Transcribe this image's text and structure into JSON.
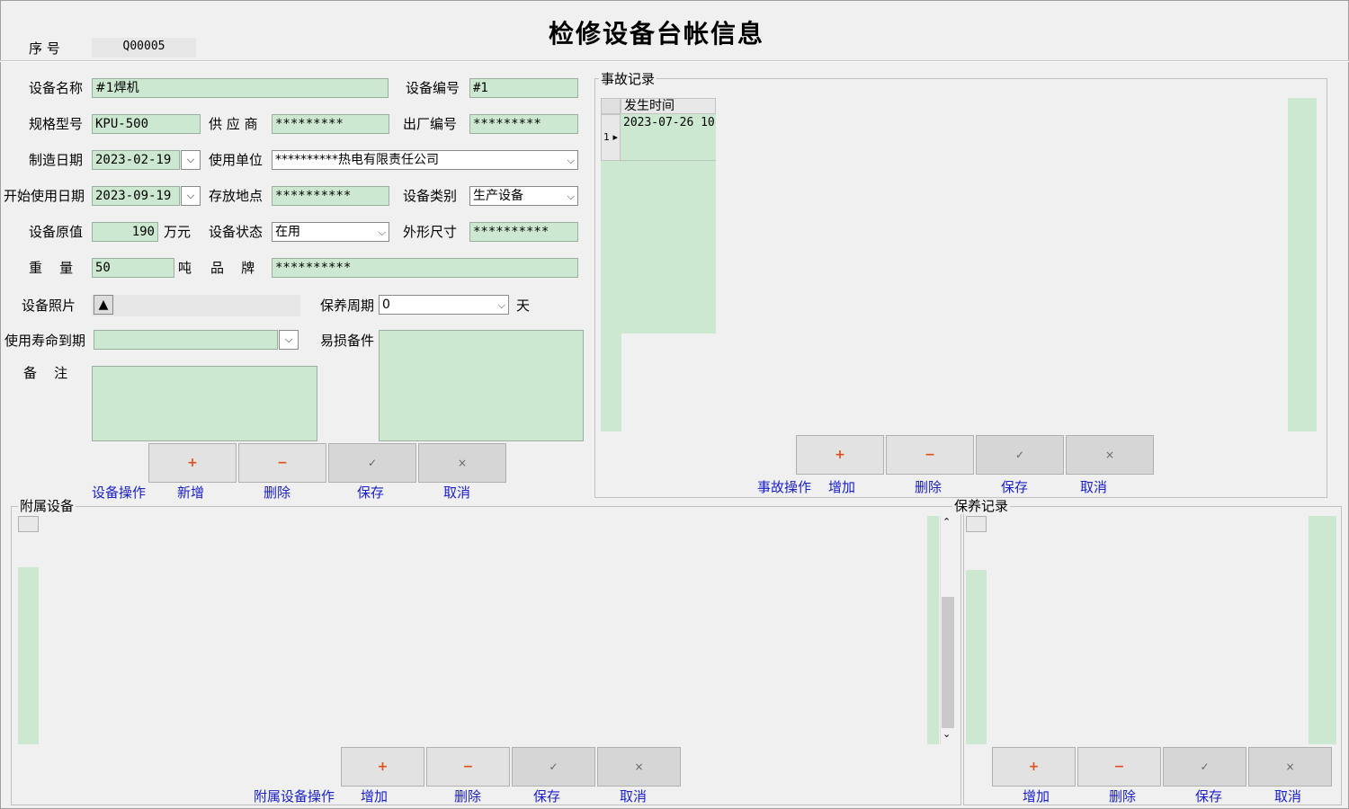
{
  "title": "检修设备台帐信息",
  "header": {
    "serial_label": "序  号",
    "serial_value": "Q00005"
  },
  "form": {
    "device_name_label": "设备名称",
    "device_name": "#1焊机",
    "device_no_label": "设备编号",
    "device_no": "#1",
    "model_label": "规格型号",
    "model": "KPU-500",
    "supplier_label": "供 应 商",
    "supplier": "*********",
    "factory_no_label": "出厂编号",
    "factory_no": "*********",
    "mfg_date_label": "制造日期",
    "mfg_date": "2023-02-19",
    "unit_label": "使用单位",
    "unit": "**********热电有限责任公司",
    "start_date_label": "开始使用日期",
    "start_date": "2023-09-19",
    "location_label": "存放地点",
    "location": "**********",
    "category_label": "设备类别",
    "category": "生产设备",
    "value_label": "设备原值",
    "value": "190",
    "value_unit": "万元",
    "status_label": "设备状态",
    "status": "在用",
    "size_label": "外形尺寸",
    "size": "**********",
    "weight_label": "重    量",
    "weight": "50",
    "weight_unit": "吨",
    "brand_label": "品    牌",
    "brand": "**********",
    "photo_label": "设备照片",
    "cycle_label": "保养周期",
    "cycle": "0",
    "cycle_unit": "天",
    "expire_label": "使用寿命到期",
    "expire": "",
    "parts_label": "易损备件",
    "parts": "",
    "remark_label": "备    注",
    "remark": ""
  },
  "device_ops": {
    "label": "设备操作",
    "add": "新增",
    "delete": "删除",
    "save": "保存",
    "cancel": "取消"
  },
  "accident": {
    "title": "事故记录",
    "col_time": "发生时间",
    "row_index": "1",
    "row_time": "2023-07-26 10",
    "ops": {
      "label": "事故操作",
      "add": "增加",
      "delete": "删除",
      "save": "保存",
      "cancel": "取消"
    }
  },
  "attached": {
    "title": "附属设备",
    "ops": {
      "label": "附属设备操作",
      "add": "增加",
      "delete": "删除",
      "save": "保存",
      "cancel": "取消"
    }
  },
  "maintenance": {
    "title": "保养记录",
    "ops": {
      "add": "增加",
      "delete": "删除",
      "save": "保存",
      "cancel": "取消"
    }
  },
  "icons": {
    "add": "+",
    "delete": "−",
    "save": "✓",
    "cancel": "×",
    "dropdown": "⌵",
    "photo": "▲"
  },
  "colors": {
    "field_bg": "#cce8d0",
    "link": "#1a20c8",
    "plus": "#e0501a"
  }
}
